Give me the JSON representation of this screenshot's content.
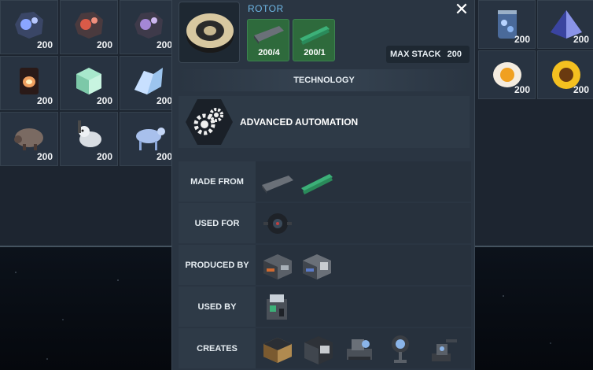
{
  "inventory_left": {
    "slots": [
      {
        "icon": "meteorite-blue-icon",
        "qty": "200"
      },
      {
        "icon": "meteorite-red-icon",
        "qty": "200"
      },
      {
        "icon": "meteorite-purple-icon",
        "qty": "200"
      },
      {
        "icon": "glowing-pot-icon",
        "qty": "200"
      },
      {
        "icon": "mint-crate-icon",
        "qty": "200"
      },
      {
        "icon": "ice-cluster-icon",
        "qty": "200"
      },
      {
        "icon": "pangolin-creature-icon",
        "qty": "200"
      },
      {
        "icon": "lemur-creature-icon",
        "qty": "200"
      },
      {
        "icon": "crystal-cow-icon",
        "qty": "200"
      }
    ]
  },
  "inventory_right": {
    "slots": [
      {
        "icon": "crystal-jar-icon",
        "qty": "200"
      },
      {
        "icon": "blue-pyramid-icon",
        "qty": "200"
      },
      {
        "icon": "fried-egg-icon",
        "qty": "200"
      },
      {
        "icon": "sunflower-icon",
        "qty": "200"
      }
    ]
  },
  "detail": {
    "item_name": "ROTOR",
    "close_label": "✕",
    "ingredients": [
      {
        "icon": "iron-plate-icon",
        "amount": "200/4"
      },
      {
        "icon": "copper-rods-icon",
        "amount": "200/1"
      }
    ],
    "max_stack_label": "MAX STACK",
    "max_stack_value": "200",
    "technology_header": "TECHNOLOGY",
    "technology_name": "ADVANCED AUTOMATION",
    "rows": {
      "made_from": {
        "label": "MADE FROM",
        "icons": [
          "iron-plate-icon",
          "copper-rods-icon"
        ]
      },
      "used_for": {
        "label": "USED FOR",
        "icons": [
          "drone-icon"
        ]
      },
      "produced_by": {
        "label": "PRODUCED BY",
        "icons": [
          "assembler-icon",
          "advanced-assembler-icon"
        ]
      },
      "used_by": {
        "label": "USED BY",
        "icons": [
          "factory-machine-icon"
        ]
      },
      "creates": {
        "label": "CREATES",
        "icons": [
          "crate-icon",
          "crusher-icon",
          "drill-machine-icon",
          "beacon-icon",
          "turret-icon"
        ]
      }
    }
  },
  "colors": {
    "accent": "#6fb8e6",
    "ingredient_bg": "#2e6a3c",
    "panel_bg": "#2a3542"
  }
}
